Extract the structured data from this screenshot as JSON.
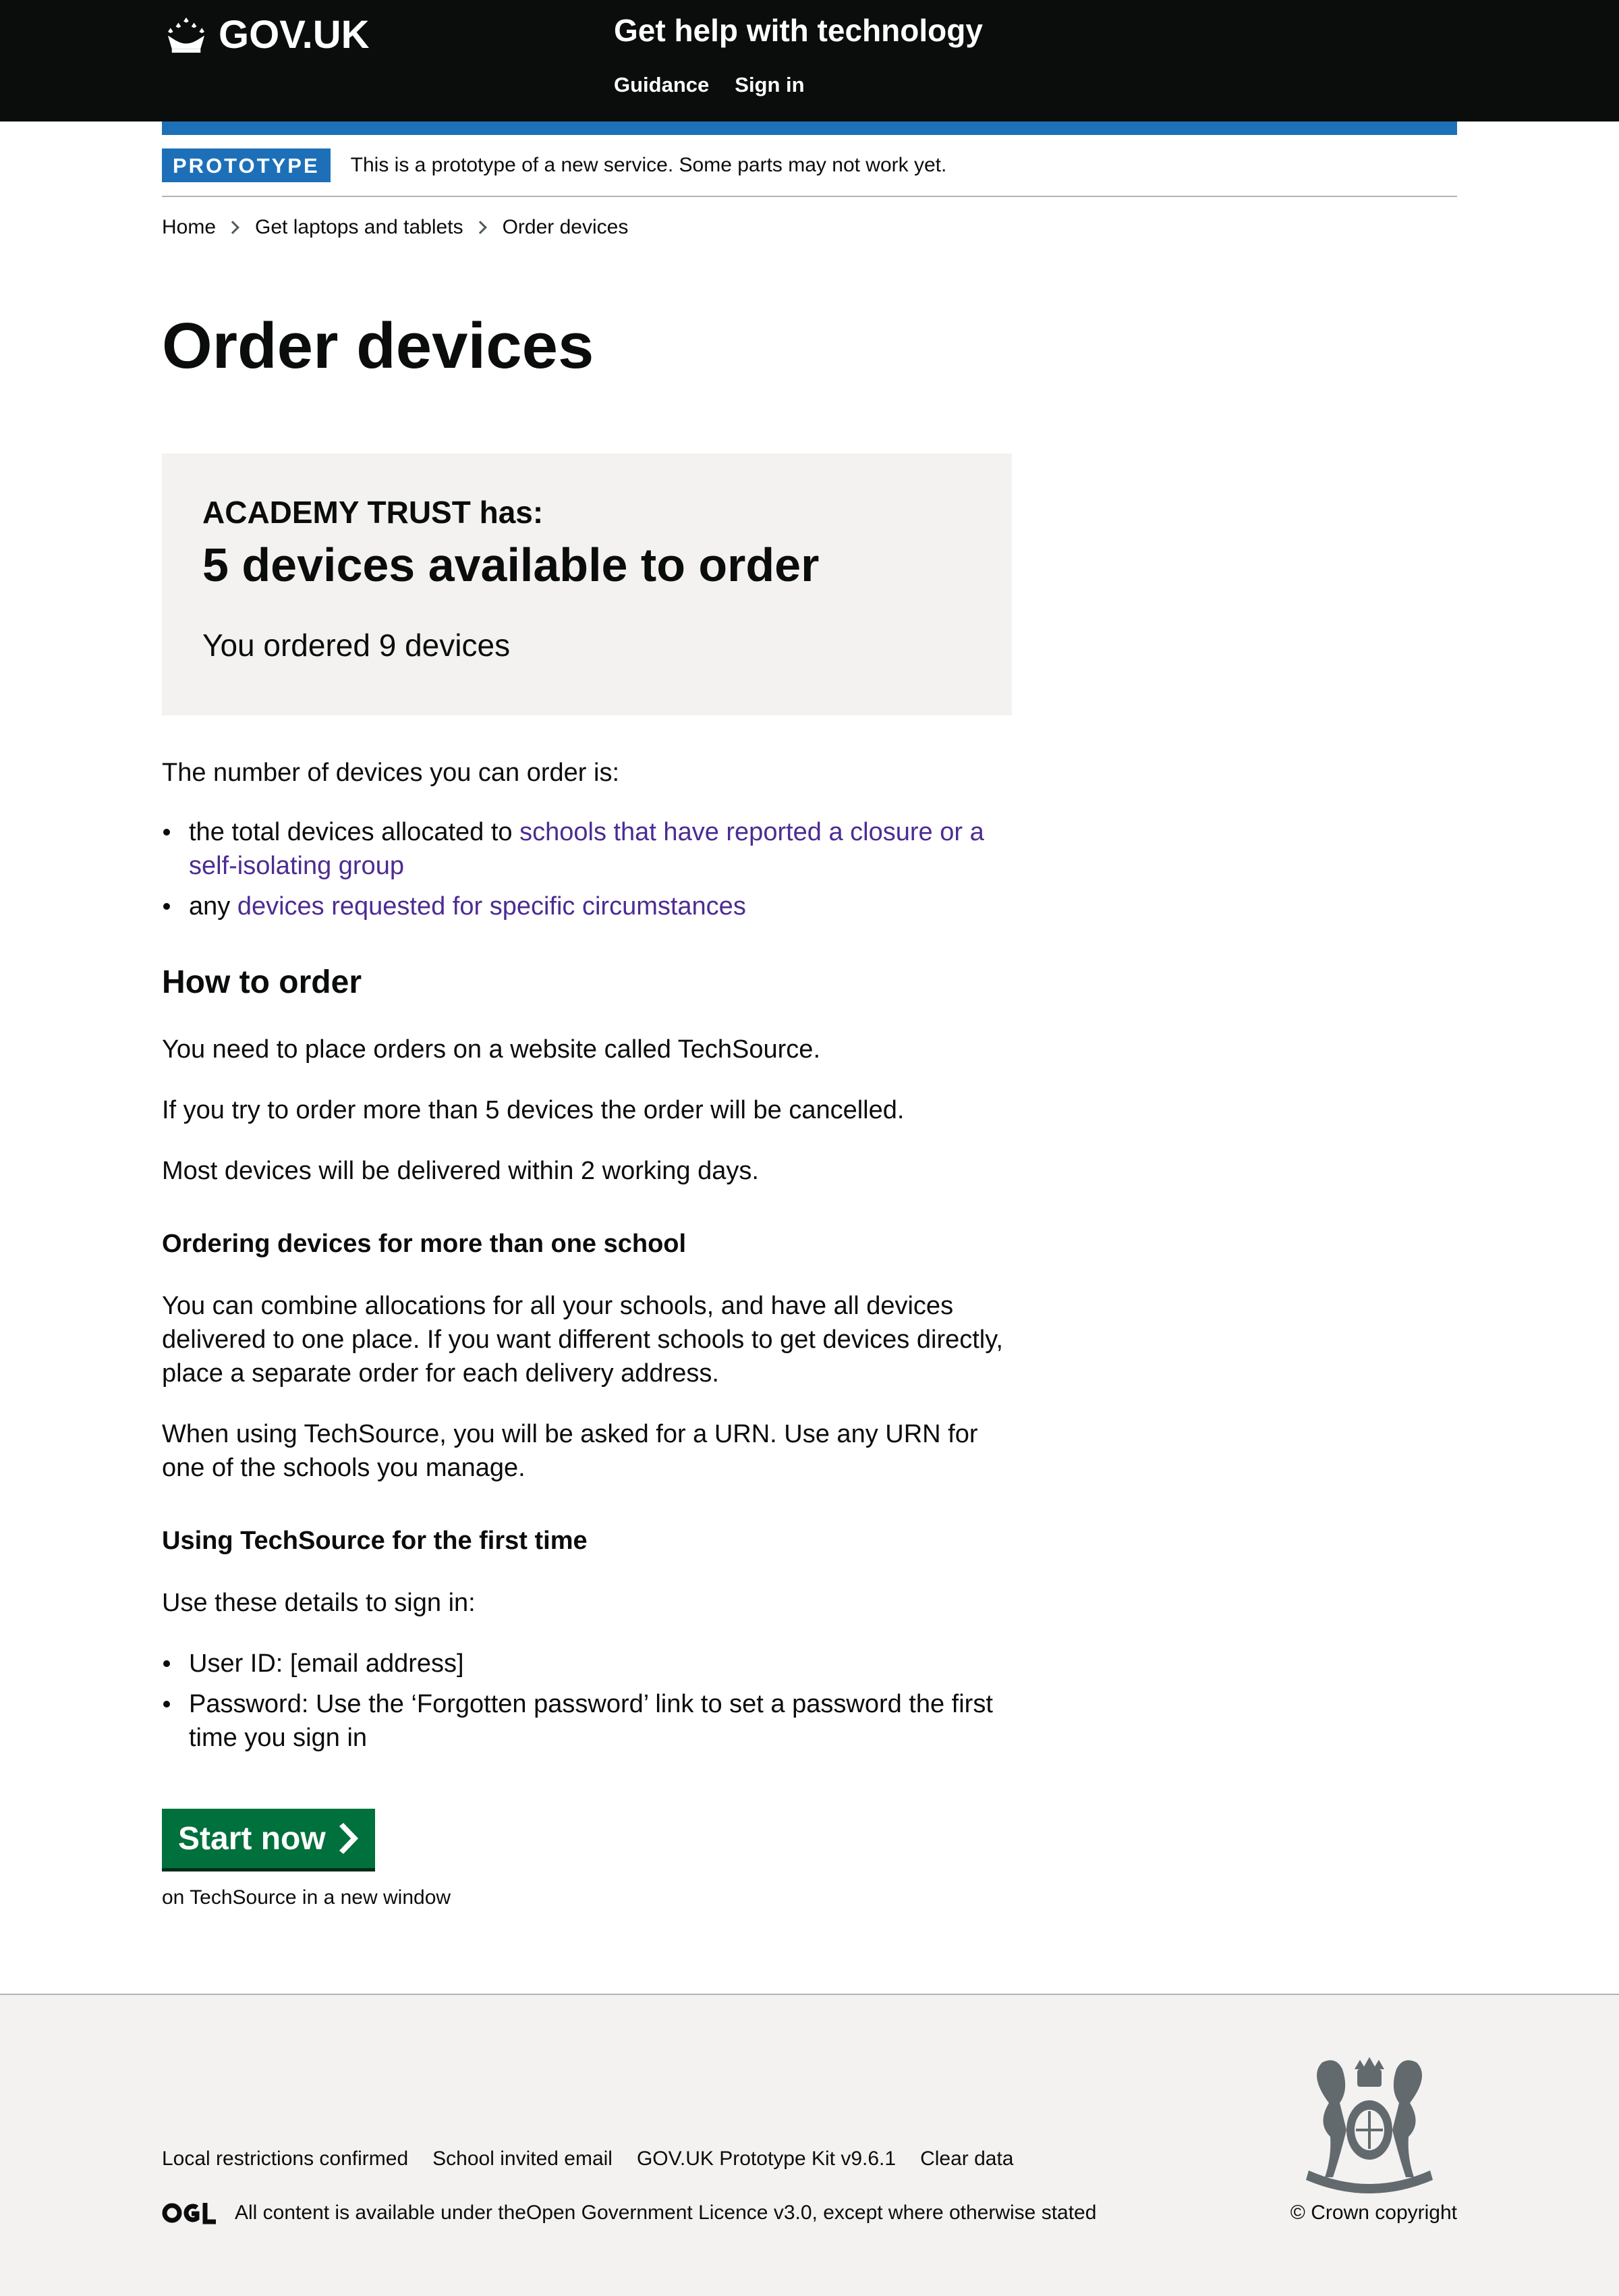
{
  "header": {
    "logo_text": "GOV.UK",
    "service_name": "Get help with technology",
    "nav": [
      {
        "label": "Guidance"
      },
      {
        "label": "Sign in"
      }
    ]
  },
  "phase_banner": {
    "tag": "PROTOTYPE",
    "text": "This is a prototype of a new service. Some parts may not work yet."
  },
  "breadcrumbs": [
    {
      "label": "Home"
    },
    {
      "label": "Get laptops and tablets"
    },
    {
      "label": "Order devices"
    }
  ],
  "page_title": "Order devices",
  "panel": {
    "subheading": "ACADEMY TRUST has:",
    "title": "5 devices available to order",
    "ordered": "You ordered 9 devices"
  },
  "intro": "The number of devices you can order is:",
  "allocation_list": [
    {
      "prefix": "the total devices allocated to ",
      "link": "schools that have reported a closure or a self-isolating group"
    },
    {
      "prefix": "any ",
      "link": "devices requested for specific circumstances"
    }
  ],
  "how_to_order": {
    "heading": "How to order",
    "p1": "You need to place orders on a website called TechSource.",
    "p2": "If you try to order more than 5 devices the order will be cancelled.",
    "p3": "Most devices will be delivered within 2 working days."
  },
  "multi_school": {
    "heading": "Ordering devices for more than one school",
    "p1": "You can combine allocations for all your schools, and have all devices delivered to one place. If you want different schools to get devices directly, place a separate order for each delivery address.",
    "p2": "When using TechSource, you will be asked for a URN. Use any URN for one of the schools you manage."
  },
  "first_time": {
    "heading": "Using TechSource for the first time",
    "intro": "Use these details to sign in:",
    "items": [
      "User ID: [email address]",
      "Password: Use the ‘Forgotten password’ link to set a password the first time you sign in"
    ]
  },
  "start": {
    "label": "Start now",
    "hint": "on TechSource in a new window"
  },
  "footer": {
    "links": [
      {
        "label": "Local restrictions confirmed"
      },
      {
        "label": "School invited email"
      },
      {
        "label": "GOV.UK Prototype Kit v9.6.1"
      },
      {
        "label": "Clear data"
      }
    ],
    "licence_prefix": "All content is available under the ",
    "licence_link": "Open Government Licence v3.0",
    "licence_suffix": ", except where otherwise stated",
    "copyright": "© Crown copyright"
  },
  "colors": {
    "header_bg": "#0b0c0c",
    "accent_blue": "#1d70b8",
    "start_green": "#00703c",
    "visited_link": "#4c2c92",
    "panel_bg": "#f3f2f1"
  }
}
